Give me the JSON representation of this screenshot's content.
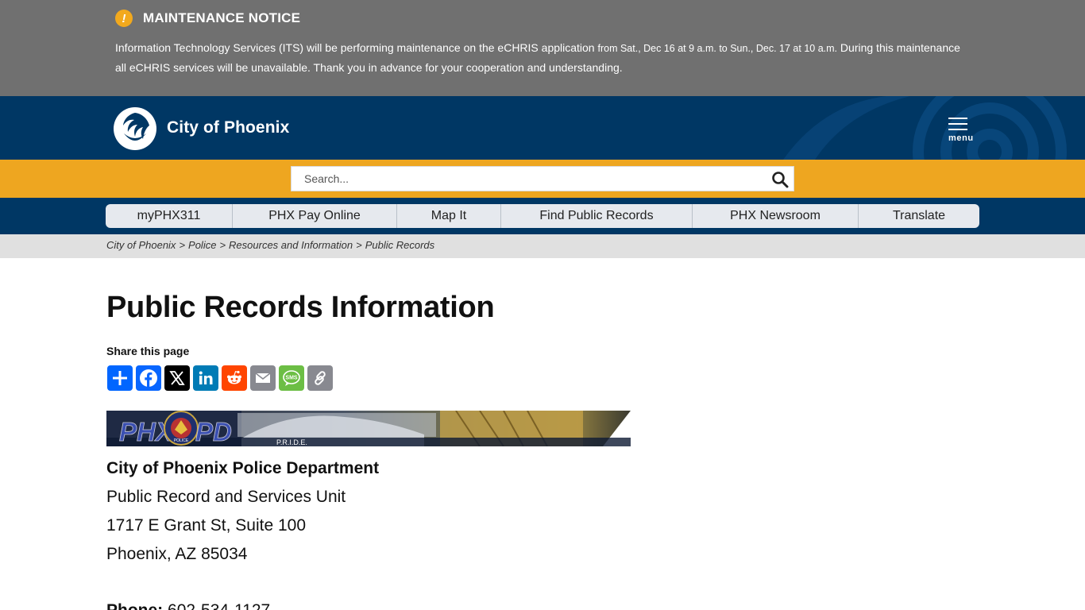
{
  "notice": {
    "icon": "alert-icon",
    "title": "MAINTENANCE NOTICE",
    "body_part1": "Information Technology Services (ITS) will be performing maintenance on the eCHRIS application ",
    "body_dates": "from Sat., Dec 16 at 9 a.m. to Sun., Dec. 17 at 10 a.m.",
    "body_part2": " During this maintenance all eCHRIS services will be unavailable. Thank you in advance for your cooperation and understanding."
  },
  "header": {
    "site_name": "City of Phoenix",
    "menu_label": "menu",
    "logo": "phoenix-bird-logo"
  },
  "search": {
    "placeholder": "Search..."
  },
  "quick_links": [
    {
      "label": "myPHX311"
    },
    {
      "label": "PHX Pay Online"
    },
    {
      "label": "Map It"
    },
    {
      "label": "Find Public Records"
    },
    {
      "label": "PHX Newsroom"
    },
    {
      "label": "Translate"
    }
  ],
  "breadcrumb": [
    {
      "label": "City of Phoenix"
    },
    {
      "label": "Police"
    },
    {
      "label": "Resources and Information"
    },
    {
      "label": "Public Records"
    }
  ],
  "breadcrumb_separator": ">",
  "page": {
    "title": "Public Records Information",
    "share_label": "Share this page"
  },
  "share_buttons": [
    {
      "name": "share-icon",
      "color": "#0166ff"
    },
    {
      "name": "facebook-icon",
      "color": "#0866ff"
    },
    {
      "name": "x-icon",
      "color": "#000000"
    },
    {
      "name": "linkedin-icon",
      "color": "#007bb5"
    },
    {
      "name": "reddit-icon",
      "color": "#ff4500"
    },
    {
      "name": "email-icon",
      "color": "#888990"
    },
    {
      "name": "sms-icon",
      "color": "#6cbe45"
    },
    {
      "name": "copy-link-icon",
      "color": "#888990"
    }
  ],
  "banner": {
    "left_text": "PHX",
    "right_text": "PD",
    "badge_text": "POLICE",
    "tagline": "P.R.I.D.E."
  },
  "contact": {
    "dept": "City of Phoenix Police Department",
    "unit": "Public Record and Services Unit",
    "street": "1717 E Grant St, Suite 100",
    "city": "Phoenix, AZ 85034",
    "phone_label": "Phone:",
    "phone": "602-534-1127"
  },
  "colors": {
    "notice_bg": "#707070",
    "header_bg": "#003764",
    "accent_gold": "#eea620",
    "breadcrumb_bg": "#e0e0e0"
  }
}
